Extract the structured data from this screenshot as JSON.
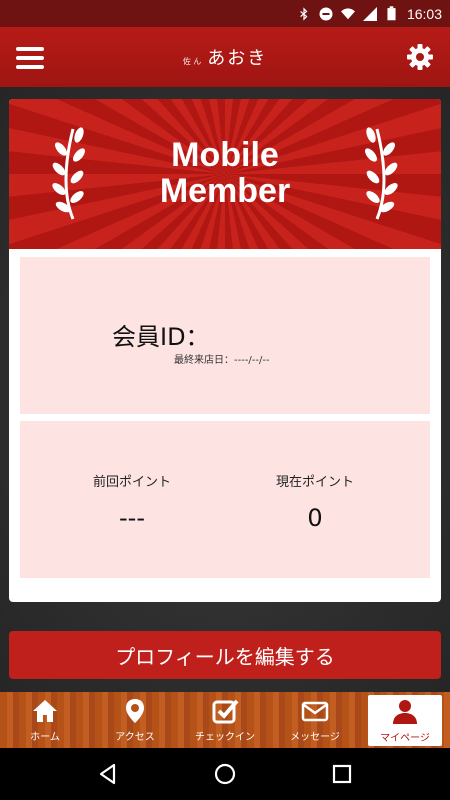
{
  "status_bar": {
    "time": "16:03"
  },
  "header": {
    "brand_sub": "佐 ん",
    "brand_main": "あおき"
  },
  "card": {
    "banner_title": "Mobile Member",
    "member_id_label": "会員ID：",
    "last_visit": "最終来店日：----/--/--",
    "points": {
      "previous_label": "前回ポイント",
      "previous_value": "---",
      "current_label": "現在ポイント",
      "current_value": "0"
    }
  },
  "edit_profile_label": "プロフィールを編集する",
  "tabs": [
    {
      "label": "ホーム",
      "icon": "home-icon"
    },
    {
      "label": "アクセス",
      "icon": "map-pin-icon"
    },
    {
      "label": "チェックイン",
      "icon": "checkin-icon"
    },
    {
      "label": "メッセージ",
      "icon": "envelope-icon"
    },
    {
      "label": "マイページ",
      "icon": "user-icon",
      "active": true
    }
  ],
  "colors": {
    "brand_red": "#b61b17",
    "panel_pink": "#fde4e3",
    "wood": "#b55218"
  }
}
